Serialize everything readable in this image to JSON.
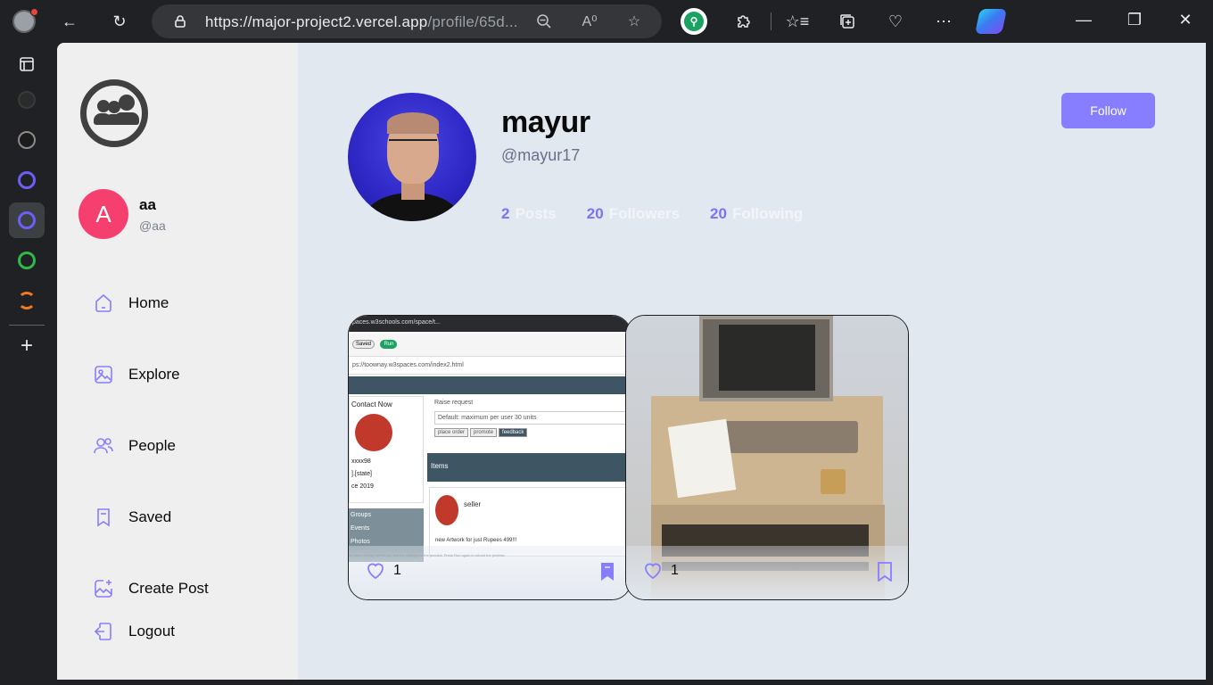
{
  "browser": {
    "url_host": "https://major-project2.vercel.app",
    "url_path": "/profile/65d..."
  },
  "app": {
    "current_user": {
      "initial": "A",
      "name": "aa",
      "handle": "@aa"
    },
    "nav": [
      {
        "label": "Home",
        "icon": "home-icon"
      },
      {
        "label": "Explore",
        "icon": "gallery-icon"
      },
      {
        "label": "People",
        "icon": "people-icon"
      },
      {
        "label": "Saved",
        "icon": "bookmark-icon"
      },
      {
        "label": "Create Post",
        "icon": "add-image-icon"
      },
      {
        "label": "Logout",
        "icon": "logout-icon"
      }
    ]
  },
  "profile": {
    "name": "mayur",
    "handle": "@mayur17",
    "follow_label": "Follow",
    "stats": [
      {
        "count": "2",
        "label": "Posts"
      },
      {
        "count": "20",
        "label": "Followers"
      },
      {
        "count": "20",
        "label": "Following"
      }
    ]
  },
  "posts": [
    {
      "likes": "1",
      "mini": {
        "url": "ps://toownay.w3spaces.com/index2.html",
        "tab_url": "paces.w3schools.com/space/t...",
        "save": "Saved",
        "run": "Run",
        "contact": "Contact Now",
        "raise": "Raise request",
        "default": "Default: maximum per user 30 units",
        "place_order": "place order",
        "promote": "promote",
        "feedback": "feedback",
        "items": "Items",
        "seller": "seller",
        "artwork": "new Artwork for just Rupees 499!!!",
        "left_lines": [
          "xxxx98",
          "].[state]",
          "ce 2019"
        ],
        "groups": [
          "Groups",
          "Events",
          "Photos"
        ],
        "footer": "lay when saving before you see the changes in the preview. Press Run again to reload the preview."
      }
    },
    {
      "likes": "1"
    }
  ],
  "colors": {
    "accent": "#877eff",
    "avatar": "#f43f6f",
    "page_bg": "#e2e8f0",
    "nav_bg": "#efefef"
  }
}
